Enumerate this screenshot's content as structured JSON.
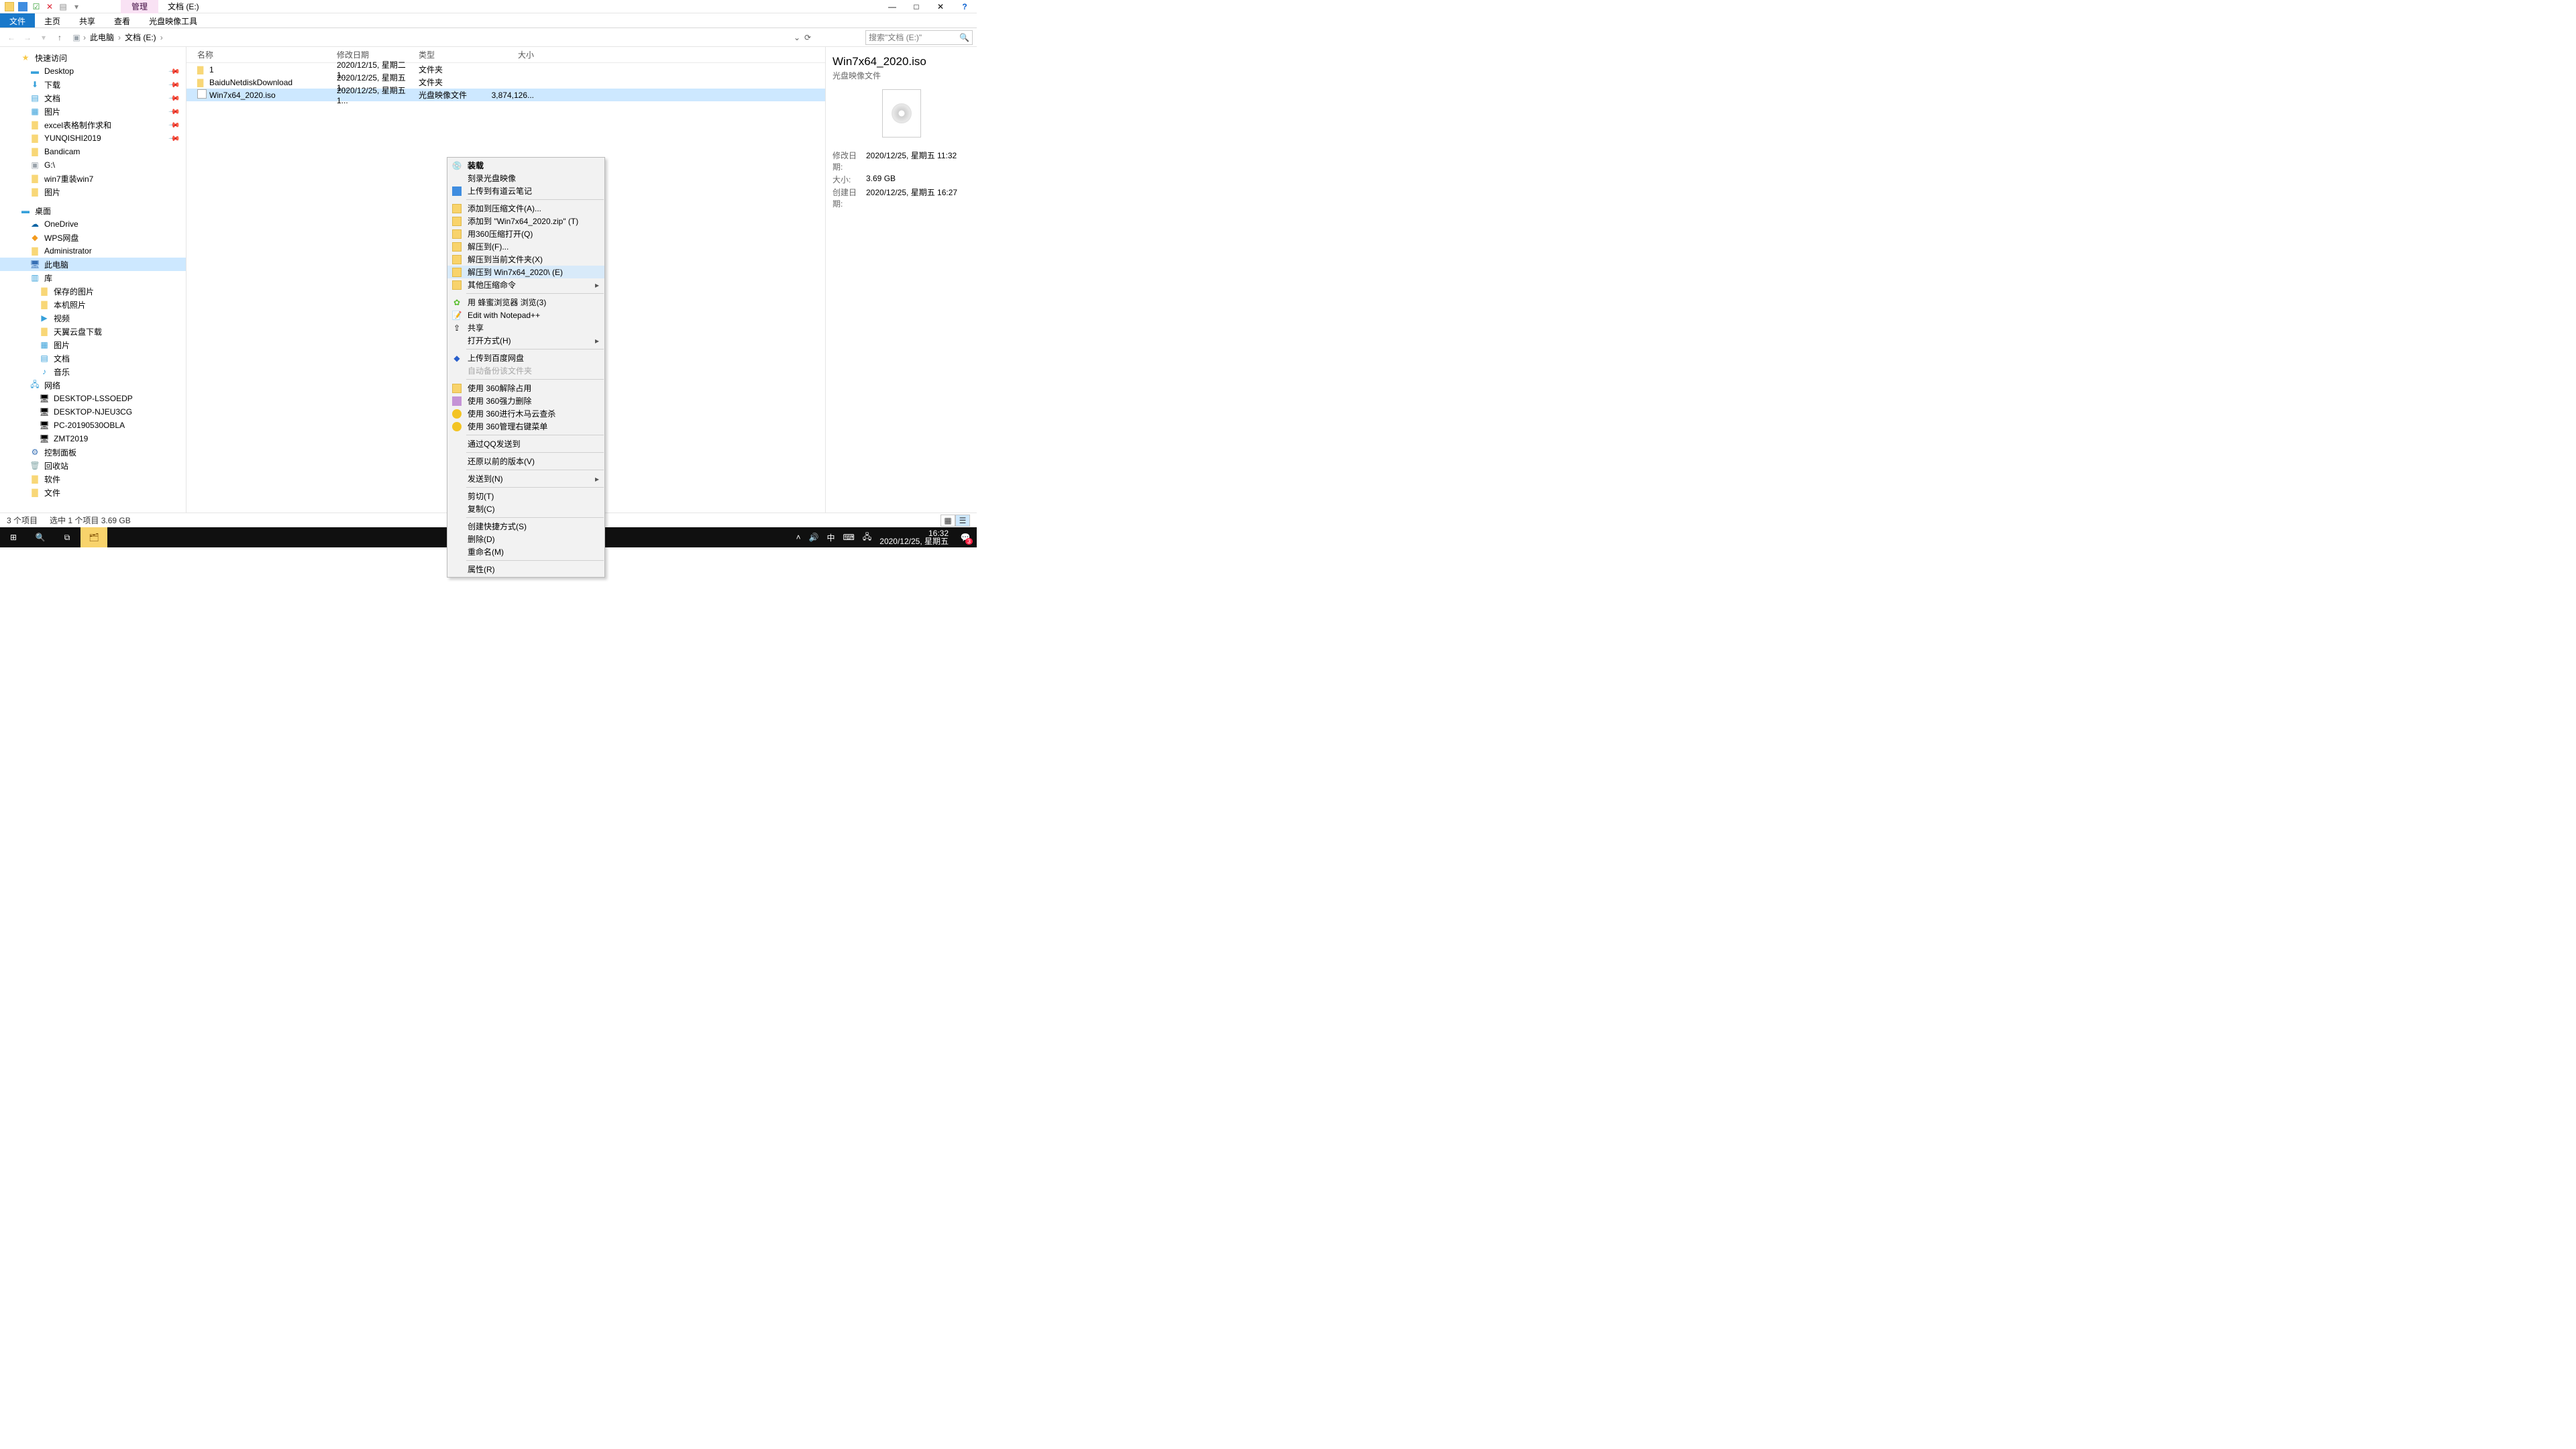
{
  "title_tab": "管理",
  "title_text": "文档 (E:)",
  "ribbon_tabs": {
    "file": "文件",
    "home": "主页",
    "share": "共享",
    "view": "查看",
    "disctools": "光盘映像工具"
  },
  "breadcrumb": {
    "root": "此电脑",
    "seg1": "文档 (E:)"
  },
  "search_placeholder": "搜索\"文档 (E:)\"",
  "tree": {
    "quick": "快速访问",
    "desktop": "Desktop",
    "download": "下载",
    "docs": "文档",
    "pics": "图片",
    "excel": "excel表格制作求和",
    "yunqishi": "YUNQISHI2019",
    "bandicam": "Bandicam",
    "gdrive": "G:\\",
    "win7re": "win7重装win7",
    "pic2": "图片",
    "deskZh": "桌面",
    "onedrive": "OneDrive",
    "wps": "WPS网盘",
    "admin": "Administrator",
    "thispc": "此电脑",
    "lib": "库",
    "savedpic": "保存的图片",
    "camera": "本机照片",
    "video": "视频",
    "tianyi": "天翼云盘下载",
    "picLib": "图片",
    "docLib": "文档",
    "musicLib": "音乐",
    "network": "网络",
    "pc1": "DESKTOP-LSSOEDP",
    "pc2": "DESKTOP-NJEU3CG",
    "pc3": "PC-20190530OBLA",
    "pc4": "ZMT2019",
    "cp": "控制面板",
    "recycle": "回收站",
    "soft": "软件",
    "files": "文件"
  },
  "columns": {
    "name": "名称",
    "date": "修改日期",
    "type": "类型",
    "size": "大小"
  },
  "rows": [
    {
      "name": "1",
      "date": "2020/12/15, 星期二 1...",
      "type": "文件夹",
      "size": ""
    },
    {
      "name": "BaiduNetdiskDownload",
      "date": "2020/12/25, 星期五 1...",
      "type": "文件夹",
      "size": ""
    },
    {
      "name": "Win7x64_2020.iso",
      "date": "2020/12/25, 星期五 1...",
      "type": "光盘映像文件",
      "size": "3,874,126..."
    }
  ],
  "ctx": {
    "mount": "装载",
    "burn": "刻录光盘映像",
    "youdao": "上传到有道云笔记",
    "addarc": "添加到压缩文件(A)...",
    "addzip": "添加到 \"Win7x64_2020.zip\" (T)",
    "open360": "用360压缩打开(Q)",
    "extractTo": "解压到(F)...",
    "extractHere": "解压到当前文件夹(X)",
    "extractFolder": "解压到 Win7x64_2020\\ (E)",
    "other": "其他压缩命令",
    "bee": "用 蜂蜜浏览器 浏览(3)",
    "npp": "Edit with Notepad++",
    "share": "共享",
    "openwith": "打开方式(H)",
    "baidu": "上传到百度网盘",
    "autobackup": "自动备份该文件夹",
    "u360a": "使用 360解除占用",
    "u360b": "使用 360强力删除",
    "u360c": "使用 360进行木马云查杀",
    "u360d": "使用 360管理右键菜单",
    "qq": "通过QQ发送到",
    "restore": "还原以前的版本(V)",
    "sendto": "发送到(N)",
    "cut": "剪切(T)",
    "copy": "复制(C)",
    "shortcut": "创建快捷方式(S)",
    "delete": "删除(D)",
    "rename": "重命名(M)",
    "prop": "属性(R)"
  },
  "details": {
    "title": "Win7x64_2020.iso",
    "subtitle": "光盘映像文件",
    "k_mod": "修改日期:",
    "v_mod": "2020/12/25, 星期五 11:32",
    "k_size": "大小:",
    "v_size": "3.69 GB",
    "k_create": "创建日期:",
    "v_create": "2020/12/25, 星期五 16:27"
  },
  "status": {
    "count": "3 个项目",
    "sel": "选中 1 个项目  3.69 GB"
  },
  "taskbar": {
    "time": "16:32",
    "date": "2020/12/25, 星期五",
    "ime": "中",
    "badge": "3"
  }
}
